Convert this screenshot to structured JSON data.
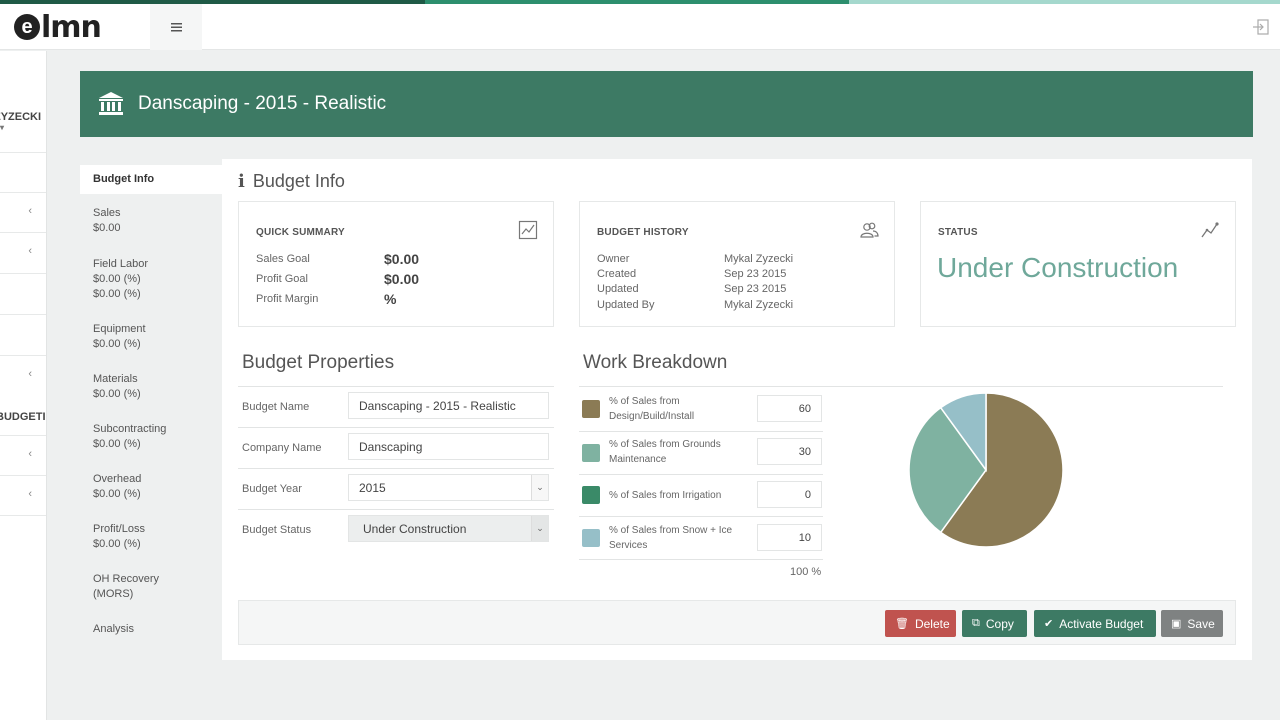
{
  "logo": {
    "mark": "e",
    "text": "lmn"
  },
  "top_stripe_colors": [
    "#1f5a46",
    "#2d8f6e",
    "#a5d8cd"
  ],
  "rail": {
    "user_name": "ZYZECKI",
    "heading": "BUDGETING"
  },
  "page_title": "Danscaping - 2015 - Realistic",
  "subnav": [
    {
      "label": "Budget Info",
      "value": "",
      "value2": ""
    },
    {
      "label": "Sales",
      "value": "$0.00",
      "value2": ""
    },
    {
      "label": "Field Labor",
      "value": "$0.00 (%)",
      "value2": "$0.00 (%)"
    },
    {
      "label": "Equipment",
      "value": "$0.00 (%)",
      "value2": ""
    },
    {
      "label": "Materials",
      "value": "$0.00 (%)",
      "value2": ""
    },
    {
      "label": "Subcontracting",
      "value": "$0.00 (%)",
      "value2": ""
    },
    {
      "label": "Overhead",
      "value": "$0.00 (%)",
      "value2": ""
    },
    {
      "label": "Profit/Loss",
      "value": "$0.00 (%)",
      "value2": ""
    },
    {
      "label": "OH Recovery",
      "value": "(MORS)",
      "value2": ""
    },
    {
      "label": "Analysis",
      "value": "",
      "value2": ""
    }
  ],
  "panel_title": "Budget Info",
  "quick_summary": {
    "title": "QUICK SUMMARY",
    "rows": [
      {
        "label": "Sales Goal",
        "value": "$0.00"
      },
      {
        "label": "Profit Goal",
        "value": "$0.00"
      },
      {
        "label": "Profit Margin",
        "value": "%"
      }
    ]
  },
  "budget_history": {
    "title": "BUDGET HISTORY",
    "rows": [
      {
        "label": "Owner",
        "value": "Mykal Zyzecki"
      },
      {
        "label": "Created",
        "value": "Sep 23 2015"
      },
      {
        "label": "Updated",
        "value": "Sep 23 2015"
      },
      {
        "label": "Updated By",
        "value": "Mykal Zyzecki"
      }
    ]
  },
  "status": {
    "title": "STATUS",
    "value": "Under Construction"
  },
  "budget_properties": {
    "title": "Budget Properties",
    "fields": [
      {
        "label": "Budget Name",
        "value": "Danscaping - 2015 - Realistic"
      },
      {
        "label": "Company Name",
        "value": "Danscaping"
      },
      {
        "label": "Budget Year",
        "value": "2015"
      },
      {
        "label": "Budget Status",
        "value": "Under Construction"
      }
    ]
  },
  "work_breakdown": {
    "title": "Work Breakdown",
    "items": [
      {
        "label": "% of Sales from Design/Build/Install",
        "value": "60",
        "color": "#8b7b55"
      },
      {
        "label": "% of Sales from Grounds Maintenance",
        "value": "30",
        "color": "#7fb2a1"
      },
      {
        "label": "% of Sales from Irrigation",
        "value": "0",
        "color": "#3a8a68"
      },
      {
        "label": "% of Sales from Snow + Ice Services",
        "value": "10",
        "color": "#96bfc8"
      }
    ],
    "total": "100 %"
  },
  "buttons": {
    "delete": "Delete",
    "copy": "Copy",
    "activate": "Activate Budget",
    "save": "Save"
  },
  "button_colors": {
    "delete": "#c0534f",
    "copy": "#3d7a64",
    "activate": "#3d7a64",
    "save": "#7f8282"
  },
  "banner_color": "#3d7a64"
}
